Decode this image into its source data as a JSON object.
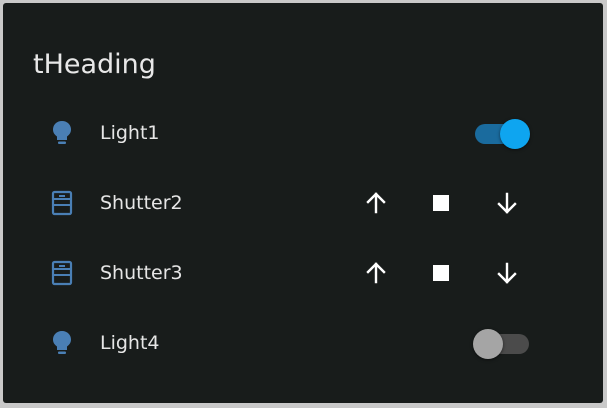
{
  "card": {
    "heading": "tHeading"
  },
  "rows": [
    {
      "label": "Light1",
      "type": "light",
      "icon": "lightbulb-icon",
      "state": "on"
    },
    {
      "label": "Shutter2",
      "type": "shutter",
      "icon": "window-shutter-icon"
    },
    {
      "label": "Shutter3",
      "type": "shutter",
      "icon": "window-shutter-icon"
    },
    {
      "label": "Light4",
      "type": "light",
      "icon": "lightbulb-icon",
      "state": "off"
    }
  ],
  "shutter_controls": {
    "up_icon": "arrow-up-icon",
    "stop_icon": "stop-icon",
    "down_icon": "arrow-down-icon"
  },
  "colors": {
    "background": "#181c1b",
    "icon_blue": "#4a7fb5",
    "toggle_on": "#0ea5f0",
    "toggle_off": "#a5a5a5",
    "text": "#e6e6e6"
  }
}
